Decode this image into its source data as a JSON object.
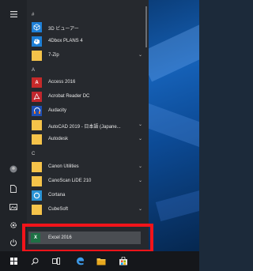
{
  "menu": {
    "sections": {
      "hash": "#",
      "a": "A",
      "c": "C"
    },
    "apps": [
      {
        "label": "3D ビューアー",
        "icon": "cube-icon"
      },
      {
        "label": "4Dbox PLANS 4",
        "icon": "4dbox-icon"
      },
      {
        "label": "7-Zip",
        "icon": "folder-icon",
        "expandable": true
      },
      {
        "label": "Access 2016",
        "icon": "access-icon"
      },
      {
        "label": "Acrobat Reader DC",
        "icon": "acrobat-icon"
      },
      {
        "label": "Audacity",
        "icon": "audacity-icon"
      },
      {
        "label": "AutoCAD 2019 - 日本語 (Japane...",
        "icon": "folder-icon",
        "expandable": true
      },
      {
        "label": "Autodesk",
        "icon": "folder-icon",
        "expandable": true
      },
      {
        "label": "Canon Utilities",
        "icon": "folder-icon",
        "expandable": true
      },
      {
        "label": "CanoScan LiDE 210",
        "icon": "folder-icon",
        "expandable": true
      },
      {
        "label": "Cortana",
        "icon": "cortana-icon"
      },
      {
        "label": "CubeSoft",
        "icon": "folder-icon",
        "expandable": true
      }
    ],
    "selected_app": {
      "label": "Excel 2016",
      "icon": "excel-icon"
    }
  },
  "rail": {
    "icons": [
      "hamburger-icon",
      "user-icon",
      "documents-icon",
      "pictures-icon",
      "settings-icon",
      "power-icon"
    ]
  },
  "taskbar": {
    "icons": [
      "windows-start-icon",
      "search-icon",
      "task-view-icon",
      "edge-icon",
      "file-explorer-icon",
      "store-icon"
    ]
  },
  "colors": {
    "highlight": "#f2141a",
    "menu_bg": "#26292e",
    "wallpaper": "#1560b6"
  }
}
